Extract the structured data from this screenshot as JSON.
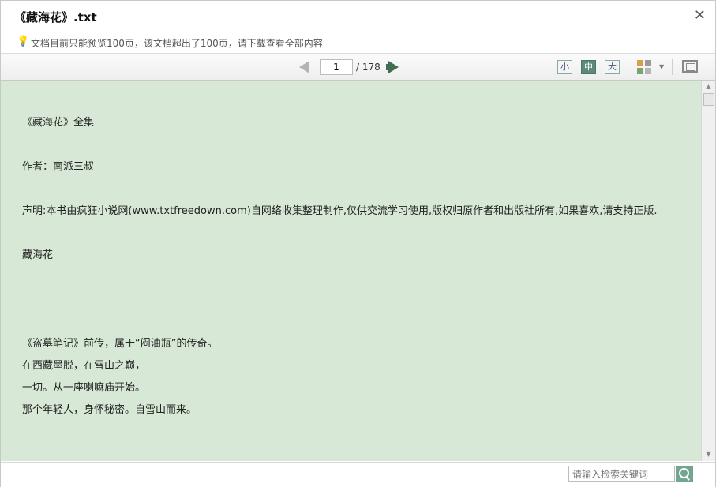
{
  "window": {
    "title": "《藏海花》.txt",
    "close_icon": "close-icon"
  },
  "notice": {
    "icon": "lightbulb-icon",
    "text": "文档目前只能预览100页，该文档超出了100页，请下载查看全部内容"
  },
  "toolbar": {
    "current_page": "1",
    "total_pages": "/ 178",
    "font_small": "小",
    "font_medium": "中",
    "font_large": "大",
    "active_font": "medium",
    "colors": {
      "accent": "#5b8a7a",
      "next_arrow": "#3f6e52",
      "prev_arrow": "#b3b3b3"
    }
  },
  "document": {
    "background": "#d7e8d6",
    "lines": [
      "《藏海花》全集",
      "",
      "作者：南派三叔",
      "",
      "声明:本书由疯狂小说网(www.txtfreedown.com)自网络收集整理制作,仅供交流学习使用,版权归原作者和出版社所有,如果喜欢,请支持正版.",
      "",
      "藏海花",
      "",
      "",
      "",
      "《盗墓笔记》前传，属于“闷油瓶”的传奇。",
      "在西藏墨脱，在雪山之巅，",
      "一切。从一座喇嘛庙开始。",
      "那个年轻人，身怀秘密。自雪山而来。"
    ]
  },
  "search": {
    "placeholder": "请输入检索关键词"
  }
}
